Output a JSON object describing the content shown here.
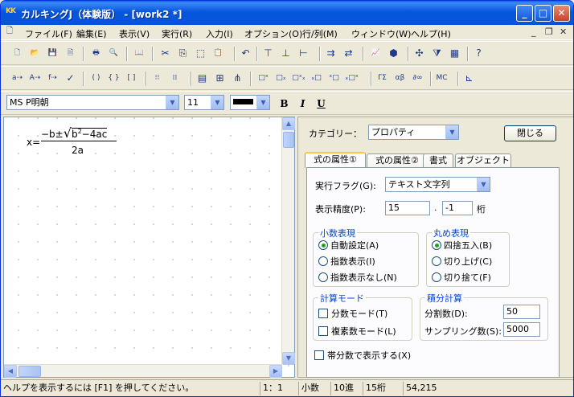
{
  "window": {
    "app_icon_text": "KK",
    "title": "カルキングJ（体験版） - [work2 *]",
    "min_label": "_",
    "max_label": "□",
    "close_label": "✕"
  },
  "menu": {
    "items": [
      "ファイル(F)",
      "編集(E)",
      "表示(V)",
      "実行(R)",
      "入力(I)",
      "オプション(O)",
      "行/列(M)",
      "ウィンドウ(W)",
      "ヘルプ(H)"
    ],
    "mdi_min": "_",
    "mdi_restore": "❐",
    "mdi_close": "✕"
  },
  "toolbar1": {
    "icons": [
      {
        "name": "new-icon",
        "glyph": "🗋"
      },
      {
        "name": "open-icon",
        "glyph": "📂"
      },
      {
        "name": "save-icon",
        "glyph": "💾"
      },
      {
        "name": "export-icon",
        "glyph": "🗎"
      },
      {
        "name": "print-icon",
        "glyph": "🖶"
      },
      {
        "name": "print-preview-icon",
        "glyph": "🔍"
      },
      {
        "name": "book-icon",
        "glyph": "📖"
      },
      {
        "name": "cut-icon",
        "glyph": "✂"
      },
      {
        "name": "copy-icon",
        "glyph": "⎘"
      },
      {
        "name": "select-box-icon",
        "glyph": "⬚"
      },
      {
        "name": "paste-icon",
        "glyph": "📋"
      },
      {
        "name": "undo-icon",
        "glyph": "↶"
      },
      {
        "name": "align-center-icon",
        "glyph": "⊤"
      },
      {
        "name": "align-equal-icon",
        "glyph": "⊥"
      },
      {
        "name": "align-left-icon",
        "glyph": "⊢"
      },
      {
        "name": "assign-icon",
        "glyph": "⇉"
      },
      {
        "name": "clear-assign-icon",
        "glyph": "⇄"
      },
      {
        "name": "graph-icon",
        "glyph": "📈"
      },
      {
        "name": "3d-graph-icon",
        "glyph": "⬢"
      },
      {
        "name": "network-icon",
        "glyph": "✣"
      },
      {
        "name": "filter-icon",
        "glyph": "⧩"
      },
      {
        "name": "grid-toggle-icon",
        "glyph": "▦"
      },
      {
        "name": "context-help-icon",
        "glyph": "?"
      }
    ]
  },
  "toolbar2": {
    "icons": [
      {
        "name": "variable-icon",
        "glyph": "a⇢"
      },
      {
        "name": "variable-bold-icon",
        "glyph": "A⇢"
      },
      {
        "name": "function-icon",
        "glyph": "f⇢"
      },
      {
        "name": "check-icon",
        "glyph": "✓"
      },
      {
        "name": "parens-icon",
        "glyph": "( )"
      },
      {
        "name": "braces-icon",
        "glyph": "{ }"
      },
      {
        "name": "brackets-icon",
        "glyph": "[ ]"
      },
      {
        "name": "matrix-icon",
        "glyph": "⁝⁝"
      },
      {
        "name": "vector-icon",
        "glyph": "⁞⁞"
      },
      {
        "name": "table-icon",
        "glyph": "▤"
      },
      {
        "name": "insert-row-icon",
        "glyph": "⊞"
      },
      {
        "name": "tree-icon",
        "glyph": "⋔"
      },
      {
        "name": "superscript-icon",
        "glyph": "□ˣ"
      },
      {
        "name": "subscript-icon",
        "glyph": "□ₓ"
      },
      {
        "name": "sup-sub-icon",
        "glyph": "□ˣₓ"
      },
      {
        "name": "pre-sub-icon",
        "glyph": "ₓ□"
      },
      {
        "name": "pre-sup-icon",
        "glyph": "ˣ□"
      },
      {
        "name": "over-under-icon",
        "glyph": "ₓ□ˣ"
      },
      {
        "name": "greek-upper-icon",
        "glyph": "ΓΣ"
      },
      {
        "name": "greek-lower-icon",
        "glyph": "αβ"
      },
      {
        "name": "symbol-icon",
        "glyph": "∂∞"
      },
      {
        "name": "macro-icon",
        "glyph": "MC"
      },
      {
        "name": "axis-icon",
        "glyph": "⊾"
      }
    ]
  },
  "format_bar": {
    "font": "MS P明朝",
    "size": "11",
    "bold_label": "B",
    "italic_label": "I",
    "underline_label": "U"
  },
  "editor": {
    "formula_lhs": "x=",
    "formula_num_a": "−b±",
    "formula_sqrt": "b",
    "formula_exp": "2",
    "formula_num_b": "−4ac",
    "formula_den": "2a"
  },
  "panel": {
    "category_label": "カテゴリー：",
    "category_value": "プロパティ",
    "close_button": "閉じる",
    "tabs": [
      "式の属性①",
      "式の属性②",
      "書式",
      "オブジェクト"
    ],
    "exec_flag_label": "実行フラグ(G):",
    "exec_flag_value": "テキスト文字列",
    "precision_label": "表示精度(P):",
    "precision_value": "15",
    "precision_dot": ".",
    "precision_decimals": "-1",
    "precision_unit": "桁",
    "decimal_group": {
      "title": "小数表現",
      "options": [
        "自動設定(A)",
        "指数表示(I)",
        "指数表示なし(N)"
      ],
      "selected": 0
    },
    "rounding_group": {
      "title": "丸め表現",
      "options": [
        "四捨五入(B)",
        "切り上げ(C)",
        "切り捨て(F)"
      ],
      "selected": 0
    },
    "calc_mode_group": {
      "title": "計算モード",
      "options": [
        "分数モード(T)",
        "複素数モード(L)"
      ]
    },
    "integral_group": {
      "title": "積分計算",
      "div_label": "分割数(D):",
      "div_value": "50",
      "sampling_label": "サンプリング数(S):",
      "sampling_value": "5000"
    },
    "mixed_fraction_label": "帯分数で表示する(X)"
  },
  "status": {
    "help": "ヘルプを表示するには [F1] を押してください。",
    "position": "1：1",
    "mode": "小数",
    "base": "10進",
    "digits": "15桁",
    "memory": "54,215"
  }
}
